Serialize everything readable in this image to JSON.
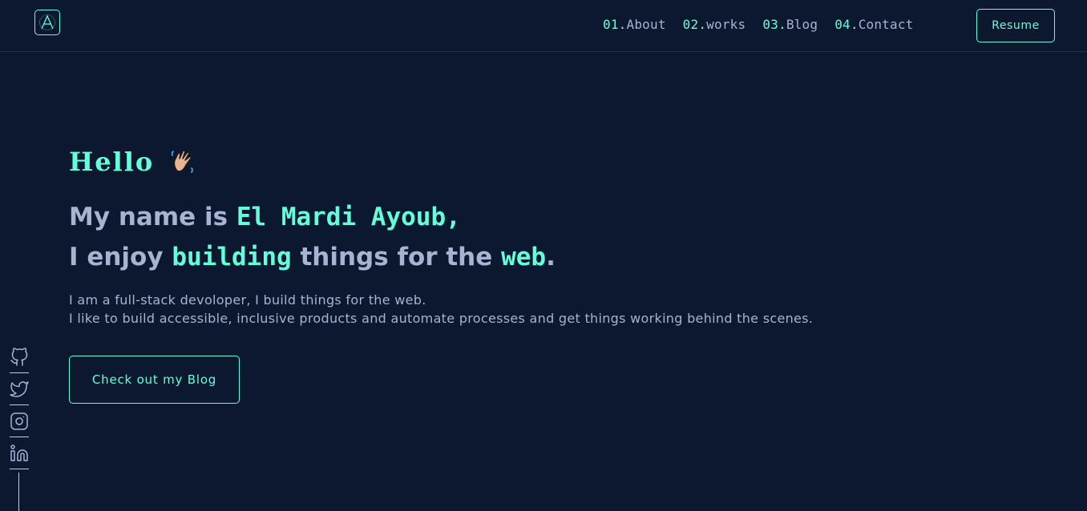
{
  "header": {
    "logo_letter": "A",
    "nav": [
      {
        "num": "01.",
        "label": "About"
      },
      {
        "num": "02.",
        "label": "works"
      },
      {
        "num": "03.",
        "label": "Blog"
      },
      {
        "num": "04.",
        "label": "Contact"
      }
    ],
    "resume_label": "Resume"
  },
  "hero": {
    "greeting": "Hello",
    "wave_icon": "waving-hand-icon",
    "line1_prefix": "My name is ",
    "line1_name": "El Mardi Ayoub,",
    "line2_part1": "I enjoy ",
    "line2_accent1": "building",
    "line2_part2": " things for the ",
    "line2_accent2": "web",
    "line2_end": ".",
    "bio_line1": "I am a full-stack devoloper, I build things for the web.",
    "bio_line2": "I like to build accessible, inclusive products and automate processes and get things working behind the scenes.",
    "cta_label": "Check out my Blog"
  },
  "social": {
    "icons": [
      "github-icon",
      "twitter-icon",
      "instagram-icon",
      "linkedin-icon"
    ]
  },
  "colors": {
    "background": "#0b1830",
    "accent": "#64ffda",
    "text": "#a8b2d1"
  }
}
